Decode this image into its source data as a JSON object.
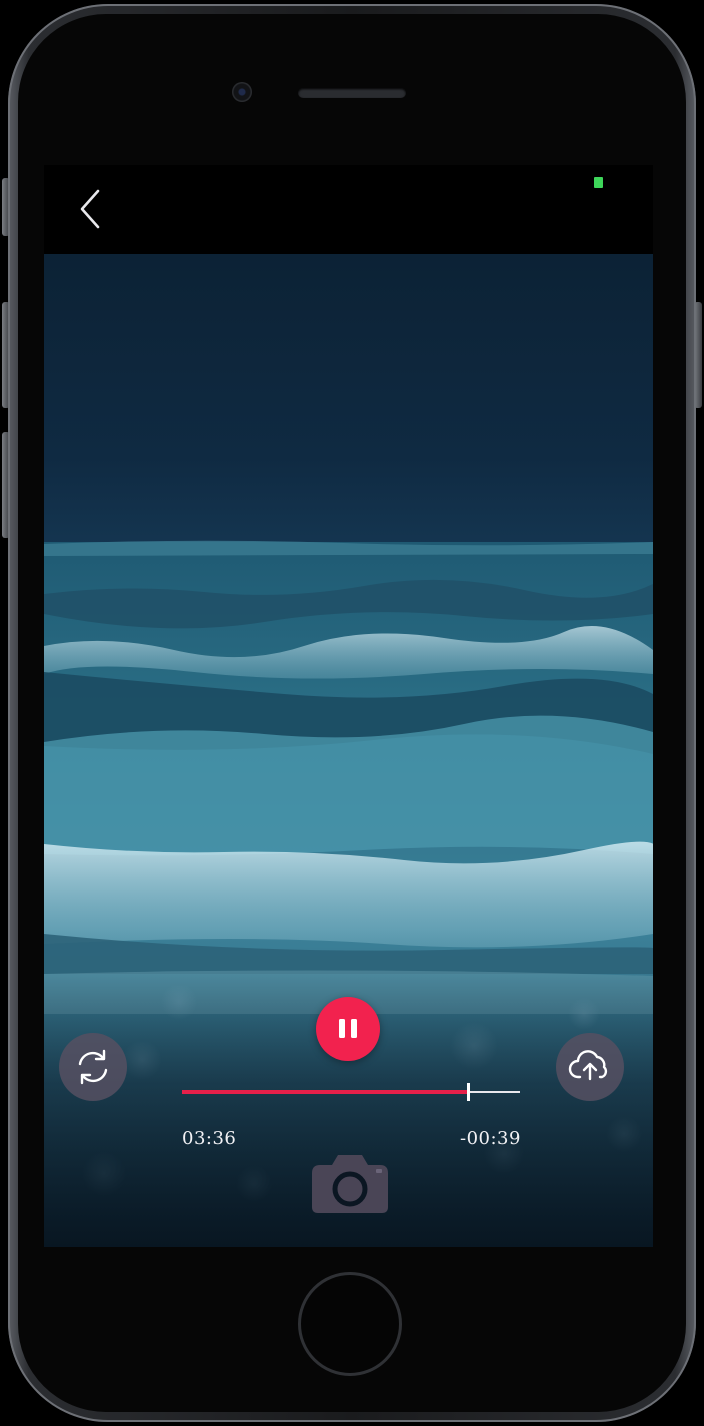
{
  "topbar": {
    "back_icon": "chevron-left-icon",
    "recording_indicator_color": "#3ed65a"
  },
  "player": {
    "elapsed": "03:36",
    "remaining": "-00:39",
    "progress_fraction": 0.847,
    "progress_color": "#e6204a",
    "pause_icon": "pause-icon",
    "pause_button_color": "#f2224e"
  },
  "actions": {
    "switch_icon": "refresh-icon",
    "upload_icon": "cloud-upload-icon",
    "camera_icon": "camera-icon"
  }
}
